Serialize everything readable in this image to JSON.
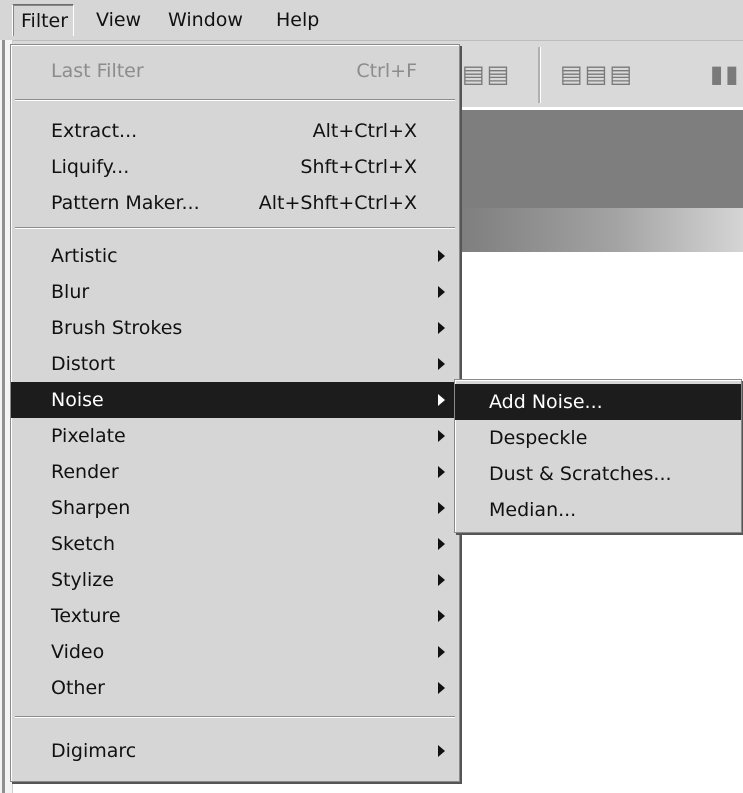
{
  "menubar": {
    "items": [
      {
        "label": "Filter"
      },
      {
        "label": "View"
      },
      {
        "label": "Window"
      },
      {
        "label": "Help"
      }
    ]
  },
  "filter_menu": {
    "last_filter": {
      "label": "Last Filter",
      "shortcut": "Ctrl+F"
    },
    "extract": {
      "label": "Extract...",
      "shortcut": "Alt+Ctrl+X"
    },
    "liquify": {
      "label": "Liquify...",
      "shortcut": "Shft+Ctrl+X"
    },
    "pattern_maker": {
      "label": "Pattern Maker...",
      "shortcut": "Alt+Shft+Ctrl+X"
    },
    "groups": [
      {
        "label": "Artistic"
      },
      {
        "label": "Blur"
      },
      {
        "label": "Brush Strokes"
      },
      {
        "label": "Distort"
      },
      {
        "label": "Noise"
      },
      {
        "label": "Pixelate"
      },
      {
        "label": "Render"
      },
      {
        "label": "Sharpen"
      },
      {
        "label": "Sketch"
      },
      {
        "label": "Stylize"
      },
      {
        "label": "Texture"
      },
      {
        "label": "Video"
      },
      {
        "label": "Other"
      }
    ],
    "digimarc": {
      "label": "Digimarc"
    }
  },
  "noise_submenu": {
    "items": [
      {
        "label": "Add Noise..."
      },
      {
        "label": "Despeckle"
      },
      {
        "label": "Dust & Scratches..."
      },
      {
        "label": "Median..."
      }
    ]
  },
  "toolbar": {
    "icons": [
      "align-icon",
      "distribute-icon"
    ]
  }
}
